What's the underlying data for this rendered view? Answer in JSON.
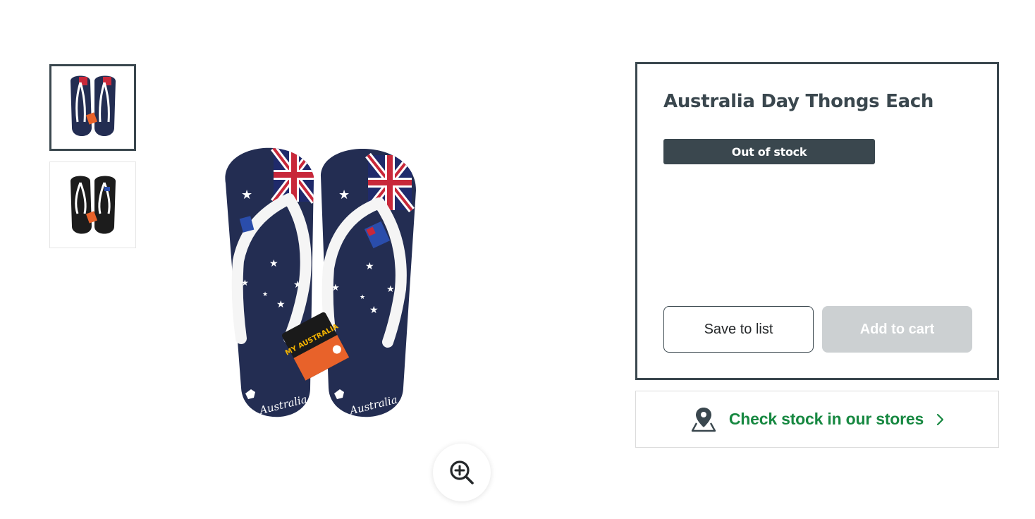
{
  "product": {
    "title": "Australia Day Thongs Each",
    "stock_status": "Out of stock"
  },
  "gallery": {
    "thumbnails": [
      {
        "label": "navy-flag-thongs",
        "active": true
      },
      {
        "label": "black-flag-thongs",
        "active": false
      }
    ],
    "tag_text": "MY AUSTRALIA",
    "sole_text": "Australia",
    "zoom_icon": "zoom-in-icon"
  },
  "actions": {
    "save_label": "Save to list",
    "cart_label": "Add to cart"
  },
  "stores": {
    "label": "Check stock in our stores",
    "icon": "map-pin-icon",
    "chevron": "chevron-right-icon"
  },
  "colors": {
    "brand_green": "#178841",
    "panel_border": "#3a474e",
    "disabled_button": "#ccd0d2",
    "thong_navy": "#232d52"
  }
}
